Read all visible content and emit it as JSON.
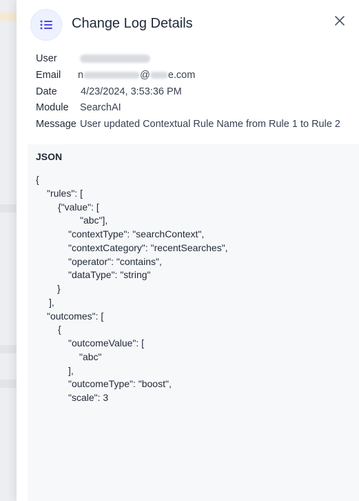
{
  "drawer": {
    "title": "Change Log Details",
    "icon": "list-icon",
    "close_icon": "close-icon"
  },
  "details": {
    "user_label": "User",
    "email_label": "Email",
    "email_prefix": "n",
    "email_at": "@",
    "email_suffix": "e.com",
    "date_label": "Date",
    "date_value": "4/23/2024, 3:53:36 PM",
    "module_label": "Module",
    "module_value": "SearchAI",
    "message_label": "Message",
    "message_value": "User updated Contextual Rule Name from Rule 1 to Rule 2"
  },
  "json_section": {
    "title": "JSON",
    "lines": [
      {
        "indent": 0,
        "text": "{"
      },
      {
        "indent": 16,
        "text": "\"rules\": ["
      },
      {
        "indent": 32,
        "text": "{\"value\": ["
      },
      {
        "indent": 64,
        "text": "\"abc\"],"
      },
      {
        "indent": 47,
        "text": "\"contextType\": \"searchContext\","
      },
      {
        "indent": 47,
        "text": "\"contextCategory\": \"recentSearches\","
      },
      {
        "indent": 47,
        "text": "\"operator\": \"contains\","
      },
      {
        "indent": 47,
        "text": "\"dataType\": \"string\""
      },
      {
        "indent": 31,
        "text": "}"
      },
      {
        "indent": 19,
        "text": "],"
      },
      {
        "indent": 16,
        "text": "\"outcomes\": ["
      },
      {
        "indent": 32,
        "text": "{"
      },
      {
        "indent": 47,
        "text": "\"outcomeValue\": ["
      },
      {
        "indent": 63,
        "text": "\"abc\""
      },
      {
        "indent": 47,
        "text": "],"
      },
      {
        "indent": 47,
        "text": "\"outcomeType\": \"boost\","
      },
      {
        "indent": 47,
        "text": "\"scale\": 3"
      }
    ]
  },
  "colors": {
    "accent": "#4f46e5",
    "icon_bg": "#eef2ff",
    "json_bg": "#f7f8fa",
    "text": "#1f2937"
  }
}
